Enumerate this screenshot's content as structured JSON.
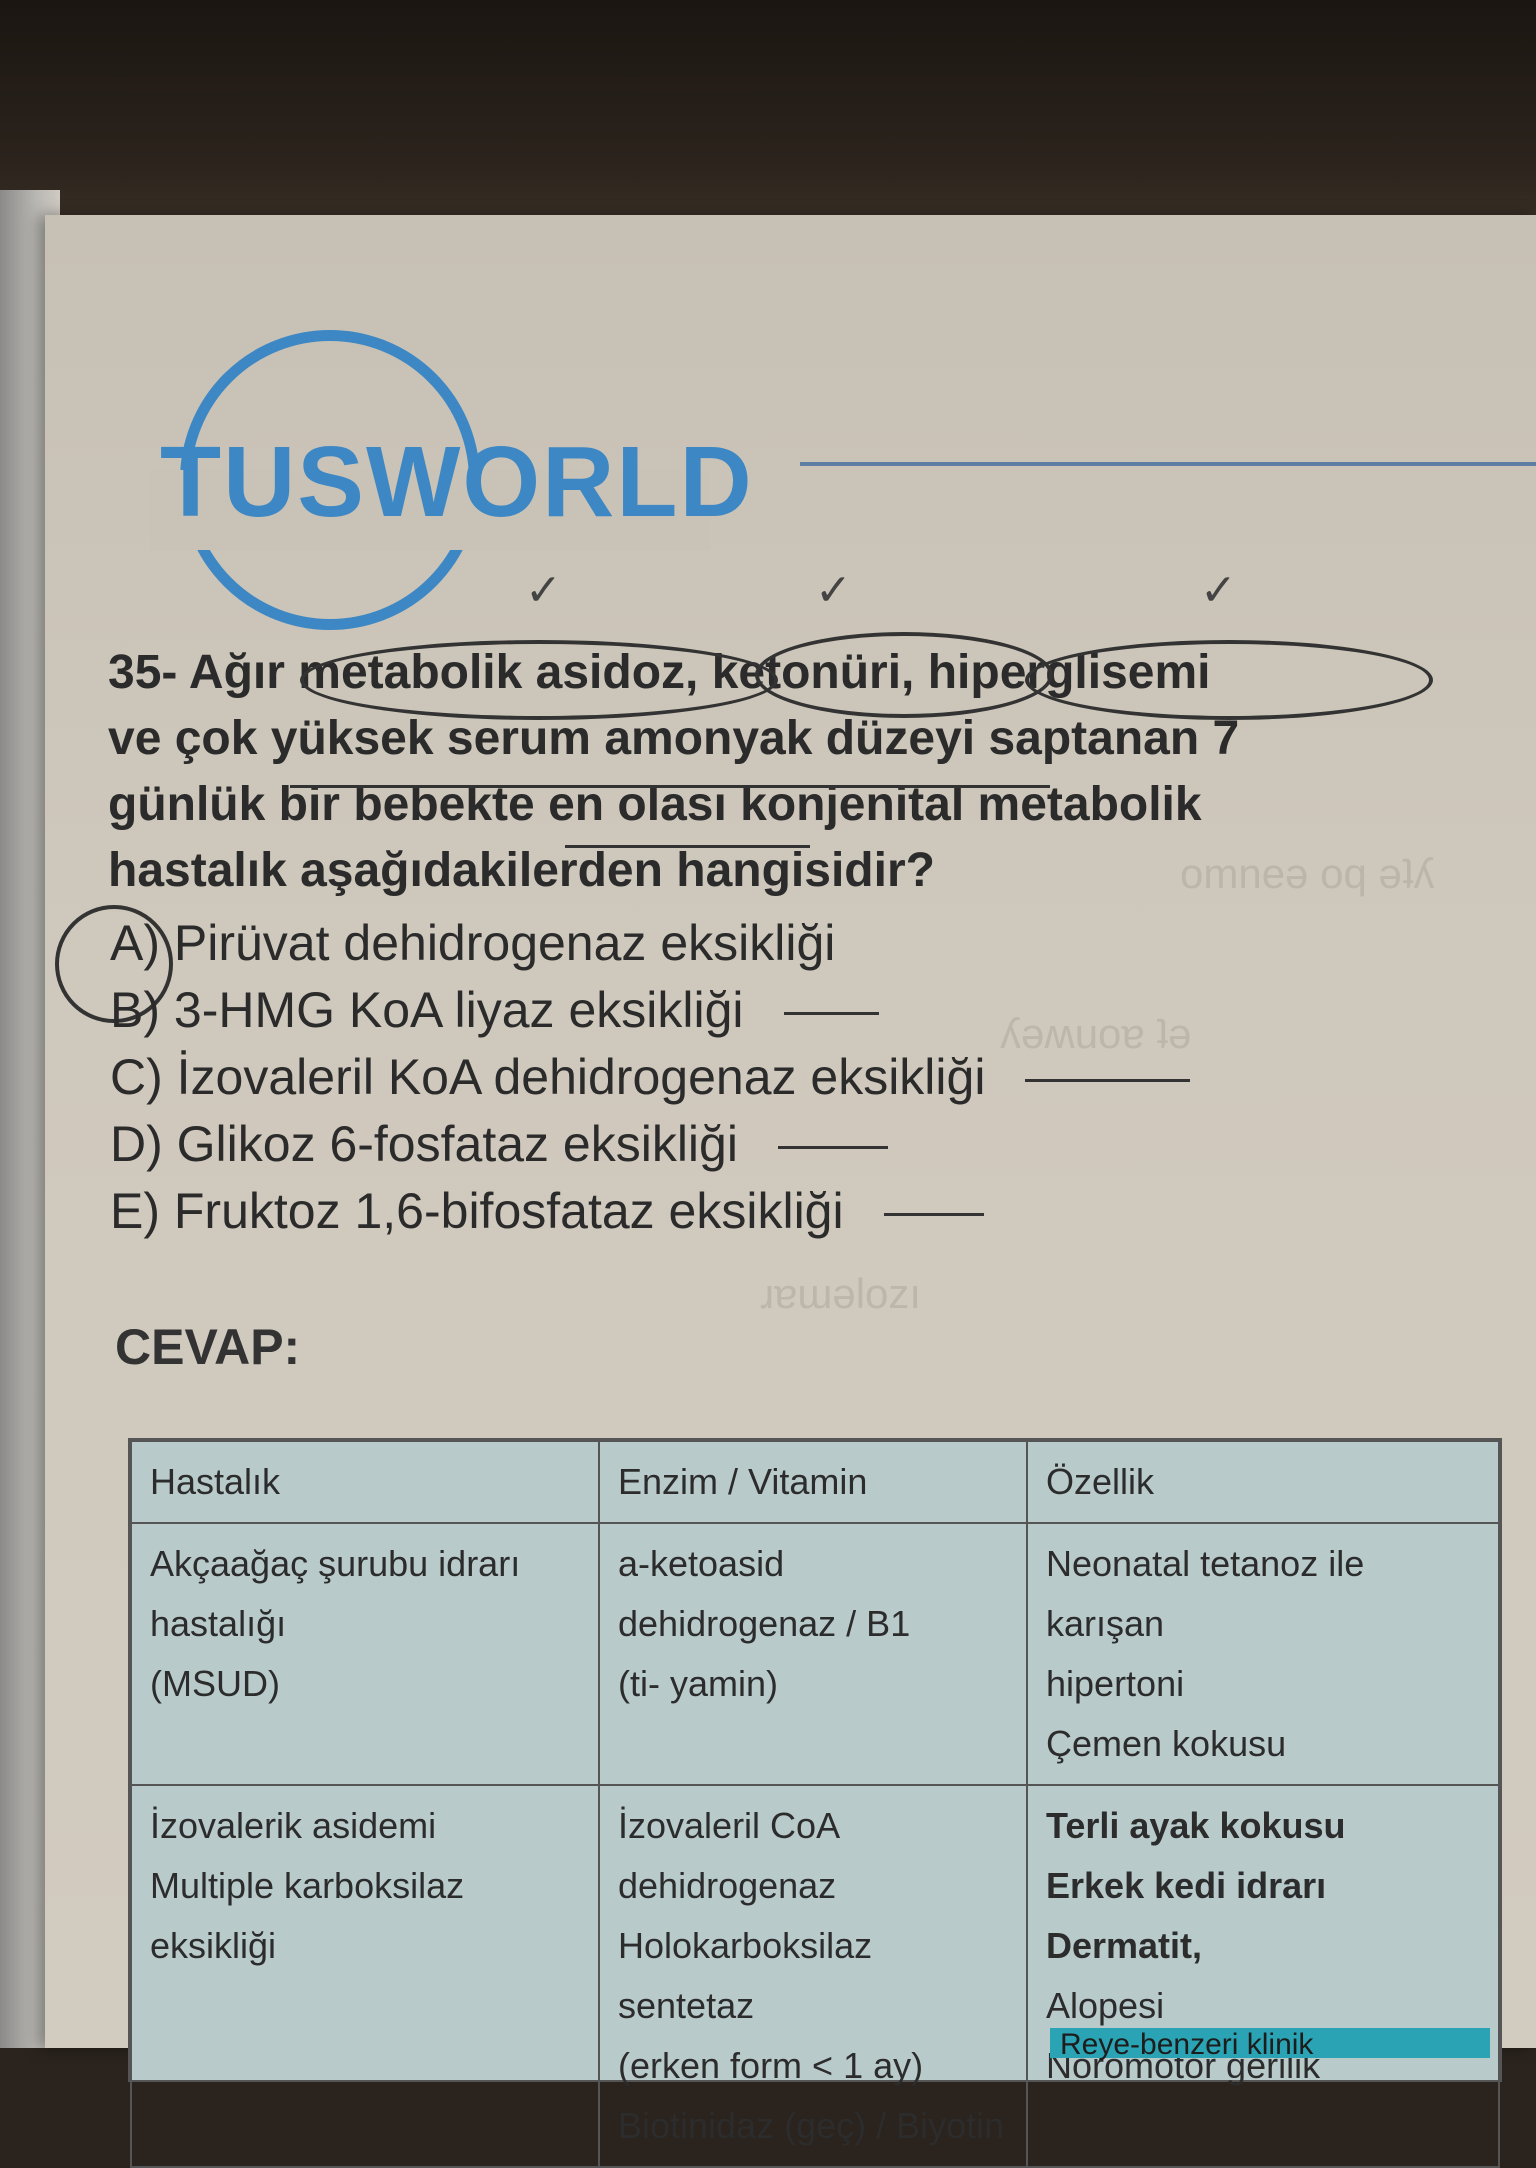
{
  "logo": {
    "text": "TUSWORLD"
  },
  "question": {
    "lines": [
      "35- Ağır metabolik asidoz, ketonüri, hiperglisemi",
      "ve çok yüksek serum amonyak düzeyi saptanan 7",
      "günlük bir bebekte en olası konjenital metabolik",
      "hastalık aşağıdakilerden hangisidir?"
    ]
  },
  "options": [
    "A) Pirüvat dehidrogenaz eksikliği",
    "B) 3-HMG KoA liyaz eksikliği",
    "C) İzovaleril KoA dehidrogenaz eksikliği",
    "D) Glikoz 6-fosfataz eksikliği",
    "E) Fruktoz 1,6-bifosfataz eksikliği"
  ],
  "cevap_label": "CEVAP:",
  "table": {
    "headers": [
      "Hastalık",
      "Enzim / Vitamin",
      "Özellik"
    ],
    "rows": [
      {
        "disease": [
          "Akçaağaç şurubu idrarı hastalığı",
          "(MSUD)"
        ],
        "enzyme": [
          "a-ketoasid dehidrogenaz / B1",
          "(ti- yamin)"
        ],
        "feature": [
          "Neonatal tetanoz ile karışan",
          "hipertoni",
          "Çemen kokusu"
        ]
      },
      {
        "disease": [
          "İzovalerik asidemi",
          "Multiple karboksilaz eksikliği"
        ],
        "enzyme": [
          "İzovaleril CoA dehidrogenaz",
          "Holokarboksilaz sentetaz",
          "(erken form < 1 ay)",
          "Biotinidaz (geç) / Biyotin"
        ],
        "feature": [
          "Terli ayak kokusu",
          "Erkek kedi idrarı Dermatit,",
          "Alopesi",
          "Nöromotor gerilik"
        ]
      }
    ]
  },
  "highlight_text": "Reye-benzeri klinik",
  "colors": {
    "logo_blue": "#3d88c4",
    "table_bg": "#b9cacb",
    "highlight": "#2aa4b5"
  }
}
